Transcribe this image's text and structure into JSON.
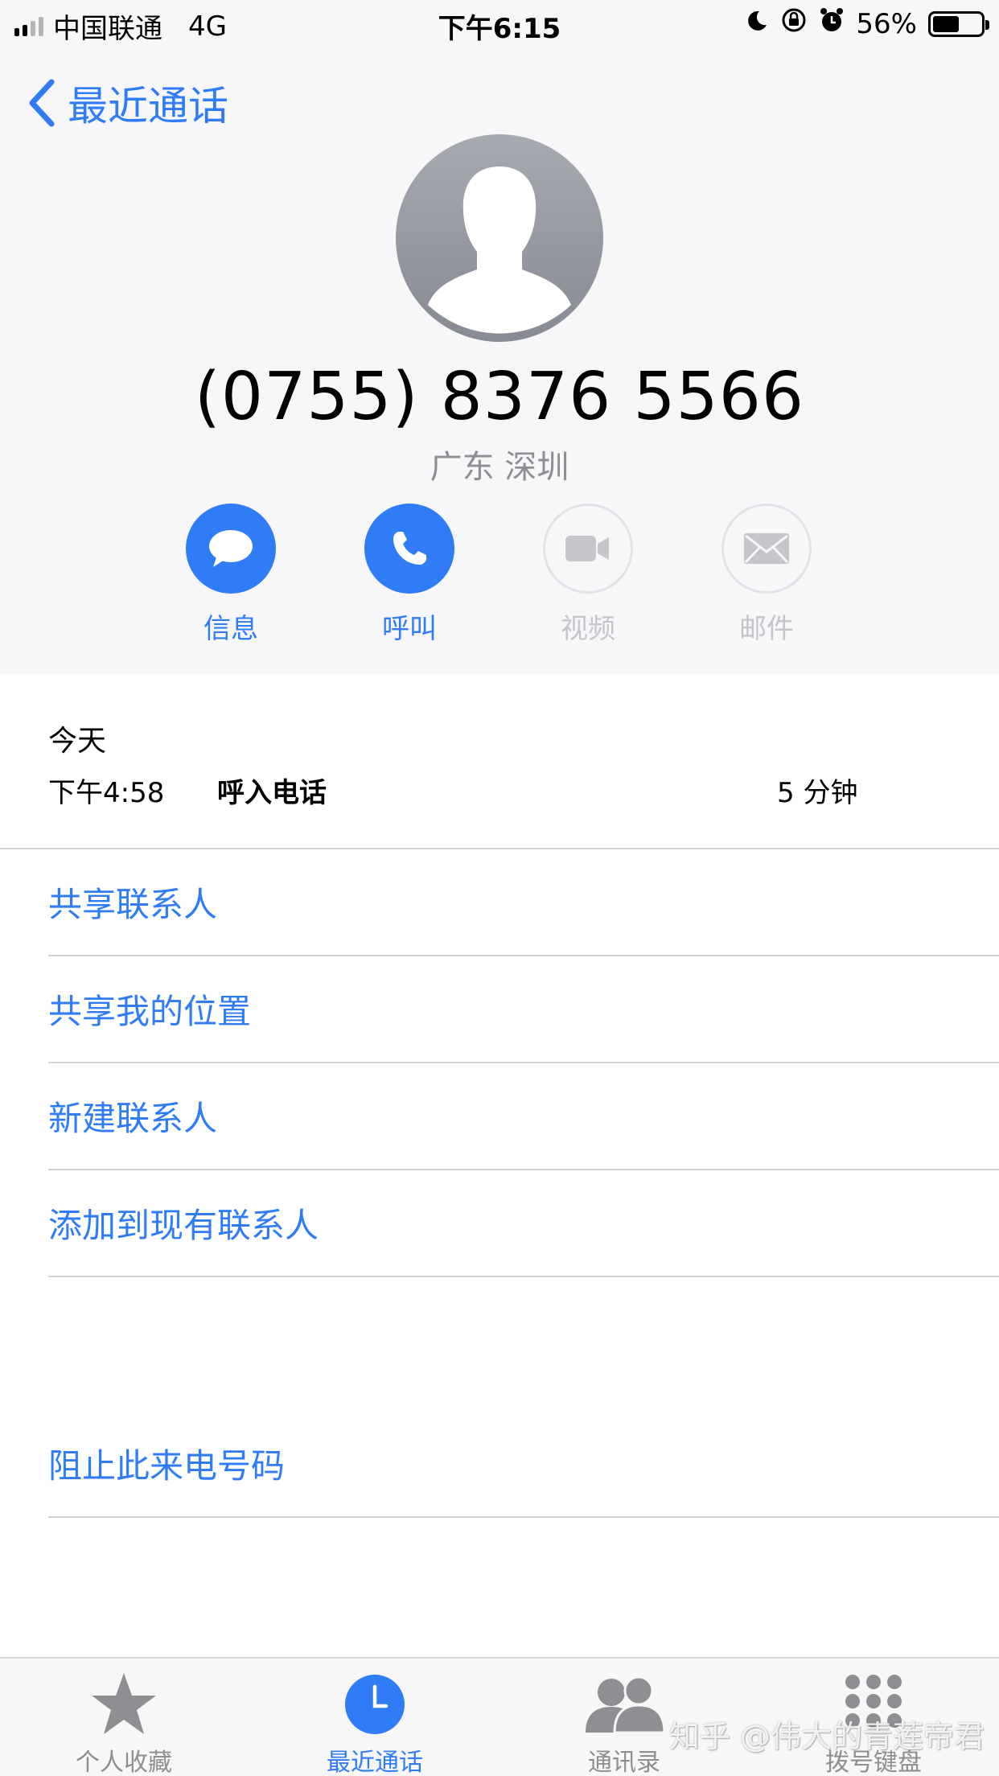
{
  "status_bar": {
    "carrier": "中国联通",
    "network": "4G",
    "time": "下午6:15",
    "battery": "56%",
    "battery_level": 0.56
  },
  "nav": {
    "back_label": "最近通话"
  },
  "contact": {
    "phone_number": "(0755) 8376 5566",
    "location": "广东 深圳"
  },
  "actions": [
    {
      "label": "信息",
      "enabled": true
    },
    {
      "label": "呼叫",
      "enabled": true
    },
    {
      "label": "视频",
      "enabled": false
    },
    {
      "label": "邮件",
      "enabled": false
    }
  ],
  "recents": {
    "day": "今天",
    "time": "下午4:58",
    "type": "呼入电话",
    "duration": "5 分钟"
  },
  "options": [
    "共享联系人",
    "共享我的位置",
    "新建联系人",
    "添加到现有联系人",
    "阻止此来电号码"
  ],
  "tabs": [
    {
      "label": "个人收藏",
      "icon": "star-icon",
      "active": false
    },
    {
      "label": "最近通话",
      "icon": "clock-icon",
      "active": true
    },
    {
      "label": "通讯录",
      "icon": "contacts-icon",
      "active": false
    },
    {
      "label": "拨号键盘",
      "icon": "keypad-icon",
      "active": false
    }
  ],
  "watermark": "知乎 @伟大的青莲帝君",
  "colors": {
    "accent": "#2f7cf6",
    "disabled": "#c5c5ca",
    "secondary_text": "#8e8e93"
  }
}
